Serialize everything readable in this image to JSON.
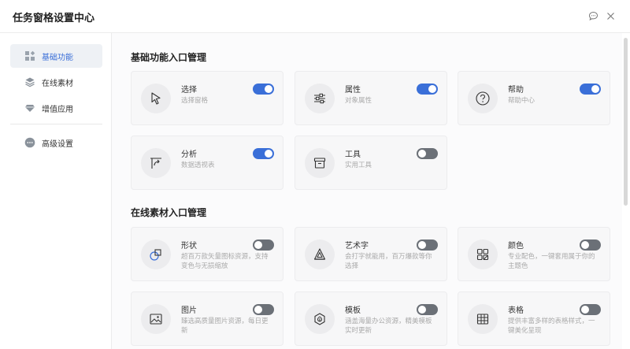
{
  "header": {
    "title": "任务窗格设置中心"
  },
  "sidebar": {
    "items": [
      {
        "label": "基础功能",
        "icon": "grid-icon",
        "active": true
      },
      {
        "label": "在线素材",
        "icon": "layers-icon",
        "active": false
      },
      {
        "label": "增值应用",
        "icon": "diamond-icon",
        "active": false
      },
      {
        "label": "高级设置",
        "icon": "more-icon",
        "active": false
      }
    ]
  },
  "sections": [
    {
      "title": "基础功能入口管理",
      "cards": [
        {
          "title": "选择",
          "desc": "选择窗格",
          "icon": "cursor-icon",
          "enabled": true
        },
        {
          "title": "属性",
          "desc": "对象属性",
          "icon": "sliders-icon",
          "enabled": true
        },
        {
          "title": "帮助",
          "desc": "帮助中心",
          "icon": "help-icon",
          "enabled": true
        },
        {
          "title": "分析",
          "desc": "数据透视表",
          "icon": "pivot-icon",
          "enabled": true
        },
        {
          "title": "工具",
          "desc": "实用工具",
          "icon": "toolbox-icon",
          "enabled": false
        }
      ]
    },
    {
      "title": "在线素材入口管理",
      "cards": [
        {
          "title": "形状",
          "desc": "超百万款矢量图标资源，支持变色与无损缩放",
          "icon": "shapes-icon",
          "enabled": false
        },
        {
          "title": "艺术字",
          "desc": "会打字就能用，百万爆款等你选择",
          "icon": "wordart-icon",
          "enabled": false
        },
        {
          "title": "颜色",
          "desc": "专业配色，一键套用属于你的主题色",
          "icon": "palette-icon",
          "enabled": false
        },
        {
          "title": "图片",
          "desc": "臻选高质量图片资源，每日更新",
          "icon": "image-icon",
          "enabled": false
        },
        {
          "title": "模板",
          "desc": "涵盖海量办公资源，精美模板实时更新",
          "icon": "template-icon",
          "enabled": false
        },
        {
          "title": "表格",
          "desc": "提供丰富多样的表格样式，一键美化呈现",
          "icon": "table-icon",
          "enabled": false
        }
      ]
    }
  ],
  "colors": {
    "accent": "#3a6fd8",
    "toggle_off": "#6b7077",
    "card_bg": "#f7f7f8",
    "main_bg": "#fbfbfc"
  }
}
